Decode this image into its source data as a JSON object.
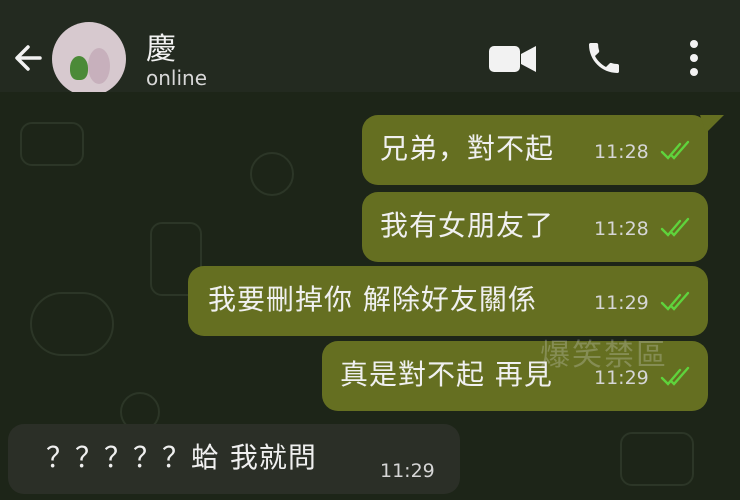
{
  "header": {
    "contact_name": "慶",
    "status": "online",
    "back_icon": "arrow-left-icon",
    "video_icon": "video-camera-icon",
    "call_icon": "phone-icon",
    "menu_icon": "more-vertical-icon"
  },
  "messages": [
    {
      "direction": "out",
      "text": "兄弟，對不起",
      "time": "11:28",
      "read": true
    },
    {
      "direction": "out",
      "text": "我有女朋友了",
      "time": "11:28",
      "read": true
    },
    {
      "direction": "out",
      "text": "我要刪掉你 解除好友關係",
      "time": "11:29",
      "read": true
    },
    {
      "direction": "out",
      "text": "真是對不起 再見",
      "time": "11:29",
      "read": true
    },
    {
      "direction": "in",
      "text": "？？？？？蛤 我就問",
      "time": "11:29"
    }
  ],
  "watermark": "爆笑禁區",
  "colors": {
    "header_bg": "#232a20",
    "chat_bg": "#1d2518",
    "outgoing_bubble": "#656f21",
    "incoming_bubble": "#2b2f27",
    "read_tick": "#5fd33c"
  }
}
